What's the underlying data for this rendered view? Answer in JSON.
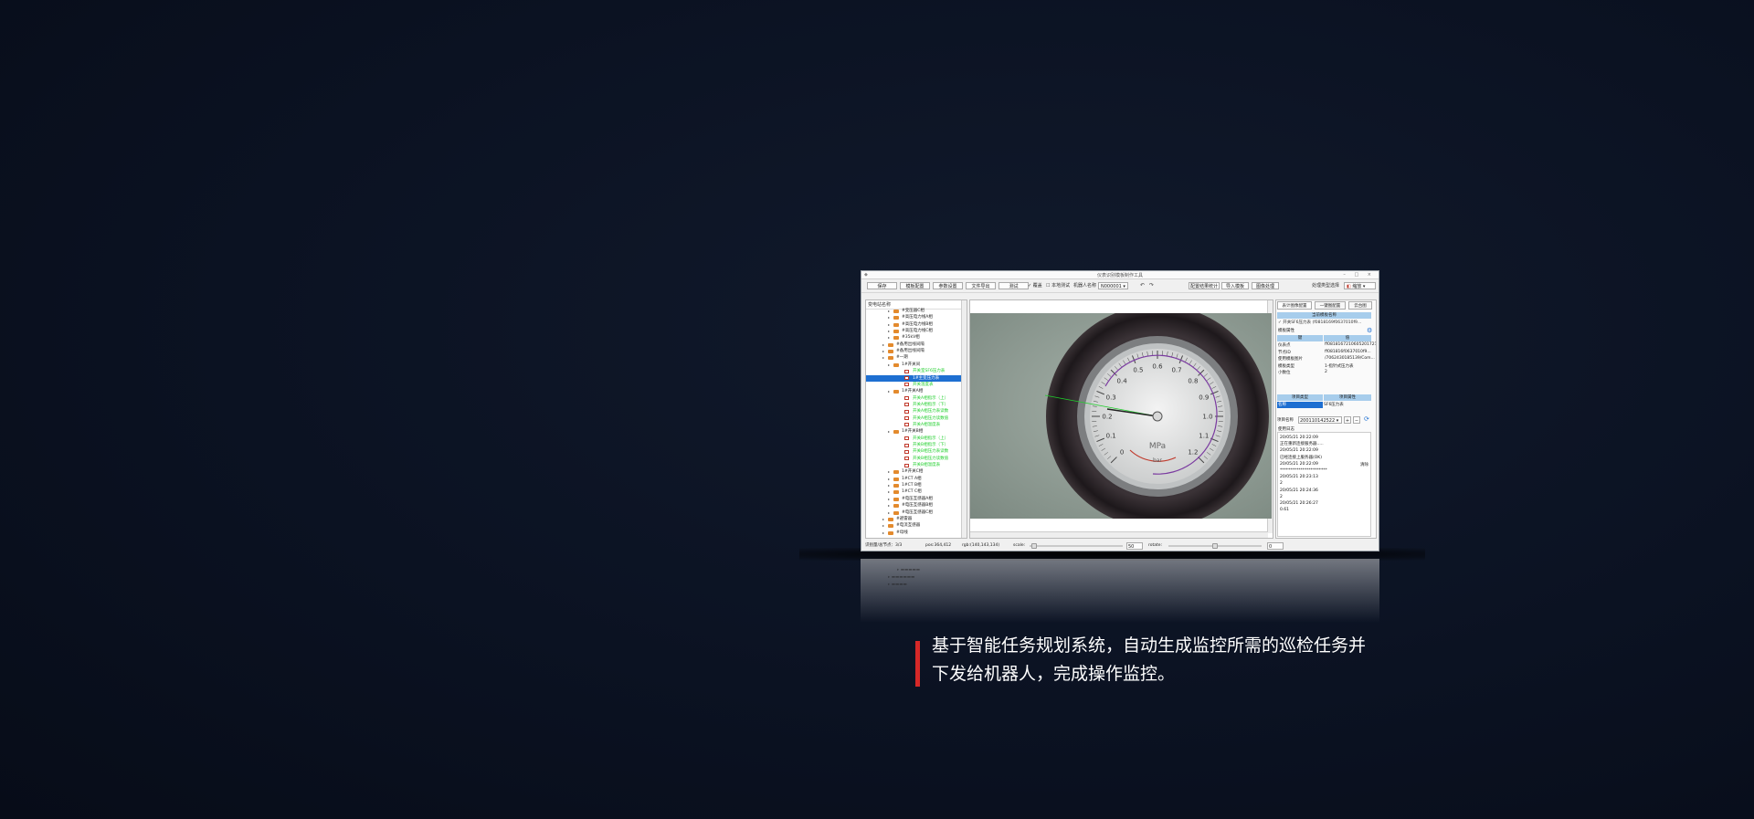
{
  "window": {
    "title": "仪表识别模板制作工具",
    "controls": "–  □  ×"
  },
  "toolbar": {
    "btn_save": "保存",
    "btn_template_config": "模板配置",
    "btn_param_setting": "参数设置",
    "btn_file_export": "文件导出",
    "btn_test": "测试",
    "chk_cover": "覆盖",
    "chk_local_test": "本地测试",
    "robot_name_label": "机器人名称",
    "robot_name_value": "N000001",
    "btn_config_result": "配置结果统计",
    "btn_import_template": "导入模板",
    "btn_image_process": "图像处理",
    "image_type_label": "处理类型选择",
    "image_type_value": "缩放"
  },
  "tree": {
    "header": "变电站名称",
    "items": [
      {
        "label": "#变压器C相",
        "type": "folder",
        "indent": 5
      },
      {
        "label": "#高压电力线A相",
        "type": "folder",
        "indent": 5
      },
      {
        "label": "#高压电力线B相",
        "type": "folder",
        "indent": 5
      },
      {
        "label": "#高压电力线C相",
        "type": "folder",
        "indent": 5
      },
      {
        "label": "#35kV相",
        "type": "folder",
        "indent": 5
      },
      {
        "label": "#备用出线间隔",
        "type": "folder",
        "indent": 4
      },
      {
        "label": "#备用出线间隔",
        "type": "folder",
        "indent": 4
      },
      {
        "label": "#一期",
        "type": "folder",
        "indent": 4
      },
      {
        "label": "1#开关间",
        "type": "folder",
        "indent": 5
      },
      {
        "label": "开关室SF6压力表",
        "type": "pic",
        "indent": 7,
        "green": true
      },
      {
        "label": "1#主变压力表",
        "type": "pic",
        "indent": 7,
        "green": true,
        "selected": true
      },
      {
        "label": "开关温度表",
        "type": "pic",
        "indent": 7,
        "green": true
      },
      {
        "label": "1#开关A相",
        "type": "folder",
        "indent": 5
      },
      {
        "label": "开关A相指示（上）",
        "type": "pic",
        "indent": 7,
        "green": true
      },
      {
        "label": "开关A相指示（下）",
        "type": "pic",
        "indent": 7,
        "green": true
      },
      {
        "label": "开关A相压力表读数",
        "type": "pic",
        "indent": 7,
        "green": true
      },
      {
        "label": "开关A相压力读数值",
        "type": "pic",
        "indent": 7,
        "green": true
      },
      {
        "label": "开关A相温度表",
        "type": "pic",
        "indent": 7,
        "green": true
      },
      {
        "label": "1#开关B相",
        "type": "folder",
        "indent": 5
      },
      {
        "label": "开关B相指示（上）",
        "type": "pic",
        "indent": 7,
        "green": true
      },
      {
        "label": "开关B相指示（下）",
        "type": "pic",
        "indent": 7,
        "green": true
      },
      {
        "label": "开关B相压力表读数",
        "type": "pic",
        "indent": 7,
        "green": true
      },
      {
        "label": "开关B相压力读数值",
        "type": "pic",
        "indent": 7,
        "green": true
      },
      {
        "label": "开关B相温度表",
        "type": "pic",
        "indent": 7,
        "green": true
      },
      {
        "label": "1#开关C相",
        "type": "folder",
        "indent": 5
      },
      {
        "label": "1#CT A相",
        "type": "folder",
        "indent": 5
      },
      {
        "label": "1#CT B相",
        "type": "folder",
        "indent": 5
      },
      {
        "label": "1#CT C相",
        "type": "folder",
        "indent": 5
      },
      {
        "label": "#电压互感器A相",
        "type": "folder",
        "indent": 5
      },
      {
        "label": "#电压互感器B相",
        "type": "folder",
        "indent": 5
      },
      {
        "label": "#电压互感器C相",
        "type": "folder",
        "indent": 5
      },
      {
        "label": "#避雷器",
        "type": "folder",
        "indent": 4
      },
      {
        "label": "#电流互感器",
        "type": "folder",
        "indent": 4
      },
      {
        "label": "#母线",
        "type": "folder",
        "indent": 4
      }
    ]
  },
  "right_panel": {
    "tabs": [
      "表计图像配置",
      "一键图配置",
      "云台图"
    ],
    "template_list_header": "当前模板名称",
    "template_item": "开关SF6压力表 (f0818169f0637010f9...",
    "props_title": "模板属性",
    "props_header_key": "键",
    "props_header_val": "值",
    "props": [
      {
        "k": "仪表点",
        "v": "ff08181672106052017211..."
      },
      {
        "k": "节点ID",
        "v": "ff081816f0637010f9..."
      },
      {
        "k": "使用模板图片",
        "v": "/7062430185139/Com..."
      },
      {
        "k": "模板类型",
        "v": "1-指针式压力表"
      },
      {
        "k": "小数位",
        "v": "2"
      }
    ],
    "proj_header_key": "项目类型",
    "proj_header_val": "项目属性",
    "proj_row_key": "名称",
    "proj_row_val": "SF6压力表",
    "proj_name_label": "项目名称",
    "proj_name_value": "200110142522",
    "log_label": "使用日志",
    "clear_label": "清除",
    "log": [
      "20/05/21 20:22:09",
      "正在重新连接服务器.....",
      "20/05/21 20:22:09",
      "已经连接上服务器(OK)",
      "20/05/21 20:22:09",
      "***********************",
      "20/05/21 20:23:13",
      "2",
      "20/05/21 20:24:36",
      "2",
      "20/05/21 20:26:27",
      "0.61"
    ]
  },
  "status": {
    "left": "识别量/总节点：3/3",
    "pos": "pos:364,412",
    "rgb": "rgb:(140,143,134)",
    "scale_label": "scale:",
    "scale_value": "50",
    "rotate_label": "rotate:",
    "rotate_value": "0"
  },
  "gauge": {
    "unit": "MPa",
    "numbers": [
      "0",
      "0.1",
      "0.2",
      "0.3",
      "0.4",
      "0.5",
      "0.6",
      "0.7",
      "0.8",
      "0.9",
      "1.0",
      "1.1",
      "1.2"
    ],
    "label_bar": "bar"
  },
  "caption": {
    "line1": "基于智能任务规划系统，自动生成监控所需的巡检任务并",
    "line2": "下发给机器人，完成操作监控。"
  },
  "colors": {
    "accent_red": "#d62828",
    "selected_blue": "#1e6fd1",
    "tree_green": "#1fcf2b"
  }
}
